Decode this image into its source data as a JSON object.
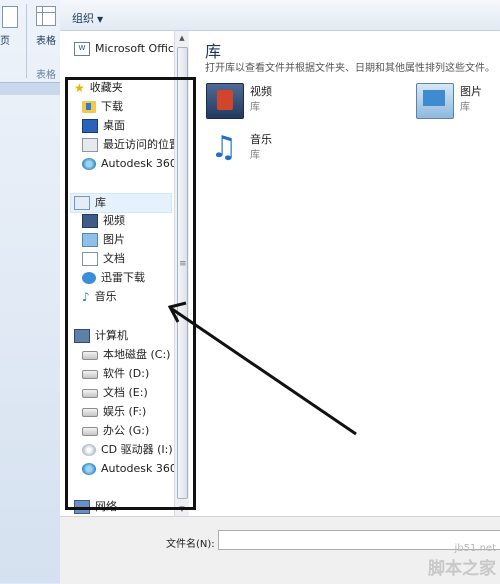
{
  "ribbon": {
    "label_page": "页",
    "label_table": "表格",
    "label_group": "表格"
  },
  "toolbar": {
    "organize_label": "组织"
  },
  "nav": {
    "top_item": "Microsoft Office",
    "favorites": {
      "header": "收藏夹",
      "items": [
        "下载",
        "桌面",
        "最近访问的位置",
        "Autodesk 360"
      ]
    },
    "libraries": {
      "header": "库",
      "items": [
        "视频",
        "图片",
        "文档",
        "迅雷下载",
        "音乐"
      ]
    },
    "computer": {
      "header": "计算机",
      "items": [
        "本地磁盘 (C:)",
        "软件 (D:)",
        "文档 (E:)",
        "娱乐 (F:)",
        "办公 (G:)",
        "CD 驱动器 (I:)",
        "Autodesk 360"
      ]
    },
    "network": {
      "header": "网络"
    }
  },
  "content": {
    "title": "库",
    "description": "打开库以查看文件并根据文件夹、日期和其他属性排列这些文件。",
    "tiles": [
      {
        "name": "视频",
        "sub": "库",
        "icon": "video-library-icon"
      },
      {
        "name": "图片",
        "sub": "库",
        "icon": "pictures-library-icon"
      },
      {
        "name": "音乐",
        "sub": "库",
        "icon": "music-library-icon"
      }
    ]
  },
  "footer": {
    "filename_label": "文件名(N):",
    "filename_value": ""
  },
  "watermark": {
    "url": "jb51.net",
    "site": "脚本之家"
  },
  "colors": {
    "accent": "#1e395b",
    "selection": "#e5f1fb",
    "highlight_box": "#111111"
  }
}
